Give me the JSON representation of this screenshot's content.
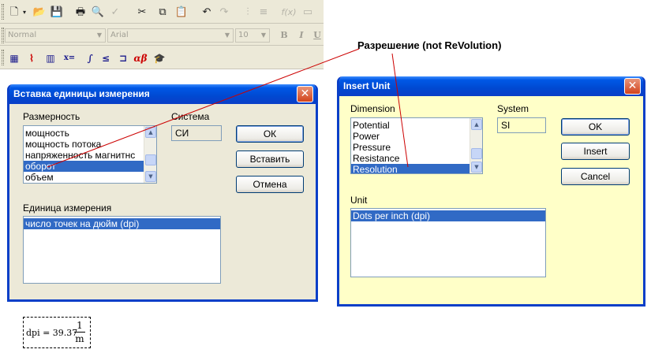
{
  "toolbar": {
    "font_style": "Normal",
    "font_name": "Arial",
    "font_size": "10",
    "bold": "B",
    "italic": "I",
    "underline": "U",
    "math_x_eq": "x=",
    "math_alpha_beta": "αβ"
  },
  "annotation": "Разрешение (not ReVolution)",
  "ru_dialog": {
    "title": "Вставка единицы измерения",
    "dimension_label": "Размерность",
    "dimensions": [
      "мощность",
      "мощность потока",
      "напряженность магнитнс",
      "оборот",
      "объем"
    ],
    "selected_dimension": 3,
    "system_label": "Система",
    "system_value": "СИ",
    "ok": "ОК",
    "insert": "Вставить",
    "cancel": "Отмена",
    "unit_label": "Единица измерения",
    "units": [
      "число точек на дюйм (dpi)"
    ]
  },
  "en_dialog": {
    "title": "Insert Unit",
    "dimension_label": "Dimension",
    "dimensions": [
      "Potential",
      "Power",
      "Pressure",
      "Resistance",
      "Resolution"
    ],
    "selected_dimension": 4,
    "system_label": "System",
    "system_value": "SI",
    "ok": "OK",
    "insert": "Insert",
    "cancel": "Cancel",
    "unit_label": "Unit",
    "units": [
      "Dots per inch (dpi)"
    ]
  },
  "equation": {
    "lhs": "dpi = 39.37",
    "numerator": "1",
    "denominator": "m"
  },
  "colors": {
    "title_bar": "#0a3fc8",
    "selection": "#316ac5",
    "en_dialog_bg": "#ffffc8",
    "dialog_bg": "#ece9d8",
    "annotation_line": "#cc0000"
  }
}
